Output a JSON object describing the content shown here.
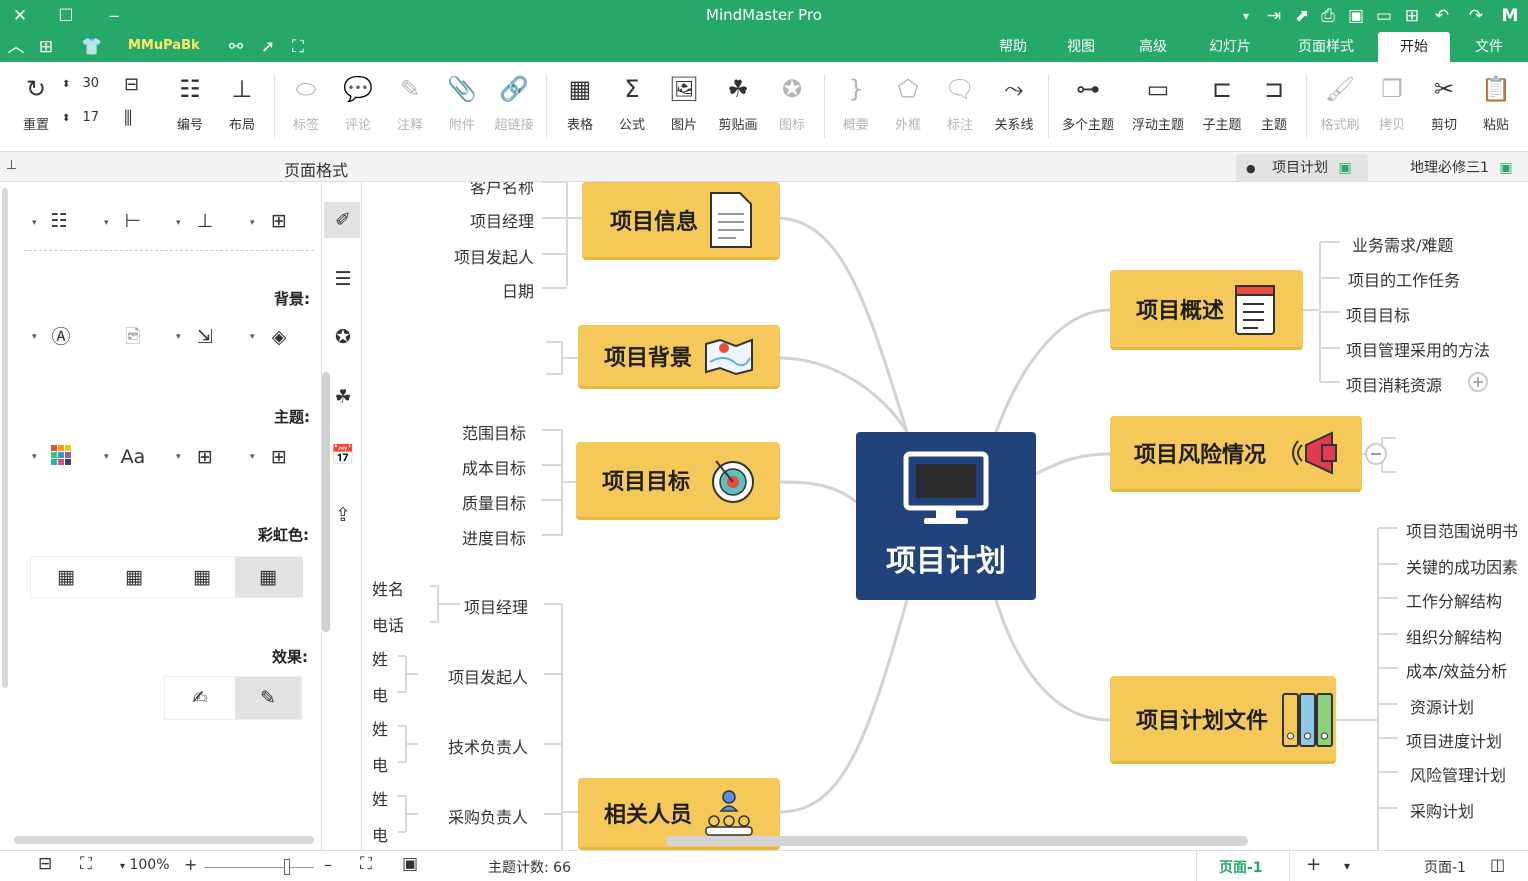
{
  "app": {
    "title": "MindMaster Pro"
  },
  "menu": {
    "tabs": [
      "文件",
      "开始",
      "页面样式",
      "幻灯片",
      "高级",
      "视图",
      "帮助"
    ],
    "active_tab": "开始",
    "brand": "MMuPaBk"
  },
  "ribbon": {
    "clipboard": {
      "paste": "粘贴",
      "cut": "剪切",
      "copy": "拷贝",
      "format_painter": "格式刷"
    },
    "topics": {
      "topic": "主题",
      "subtopic": "子主题",
      "floating": "浮动主题",
      "multiple": "多个主题",
      "relationship": "关系线"
    },
    "insert": {
      "callout": "标注",
      "boundary": "外框",
      "summary": "概要",
      "icon": "图标",
      "clipart": "剪贴画",
      "image": "图片",
      "formula": "公式",
      "table": "表格",
      "hyperlink": "超链接",
      "attachment": "附件",
      "note": "注释",
      "comment": "评论",
      "tag": "标签"
    },
    "layout": {
      "numbering": "编号",
      "layout": "布局",
      "reset": "重置",
      "spin_top": "30",
      "spin_bottom": "17"
    }
  },
  "doc_tabs": [
    {
      "label": "地理必修三1"
    },
    {
      "label": "项目计划"
    }
  ],
  "left_panel": {
    "title": "页面格式",
    "sections": {
      "background": "背景:",
      "theme": "主题:",
      "rainbow": "彩虹色:",
      "effect": "效果:"
    }
  },
  "mindmap": {
    "central": "项目计划",
    "right": [
      {
        "title": "项目概述",
        "children": [
          "业务需求/难题",
          "项目的工作任务",
          "项目目标",
          "项目管理采用的方法",
          "项目消耗资源"
        ]
      },
      {
        "title": "项目风险情况",
        "children": []
      },
      {
        "title": "项目计划文件",
        "children": [
          "项目范围说明书",
          "关键的成功因素",
          "工作分解结构",
          "组织分解结构",
          "成本/效益分析",
          "资源计划",
          "项目进度计划",
          "风险管理计划",
          "采购计划"
        ]
      }
    ],
    "left": [
      {
        "title": "项目信息",
        "children": [
          "客户名称",
          "项目经理",
          "项目发起人",
          "日期"
        ]
      },
      {
        "title": "项目背景",
        "children": []
      },
      {
        "title": "项目目标",
        "children": [
          "范围目标",
          "成本目标",
          "质量目标",
          "进度目标"
        ]
      },
      {
        "title": "相关人员",
        "children": [
          {
            "label": "项目经理",
            "details": [
              "姓名",
              "电话"
            ]
          },
          {
            "label": "项目发起人",
            "details": [
              "姓",
              "电"
            ]
          },
          {
            "label": "技术负责人",
            "details": [
              "姓",
              "电"
            ]
          },
          {
            "label": "采购负责人",
            "details": [
              "姓",
              "电"
            ]
          }
        ]
      }
    ]
  },
  "status": {
    "topic_count": "主题计数: 66",
    "zoom": "100%",
    "page_active": "页面-1",
    "page_tab": "页面-1"
  },
  "colors": {
    "accent": "#26a968",
    "topic": "#f5c85a",
    "central": "#21427a"
  }
}
